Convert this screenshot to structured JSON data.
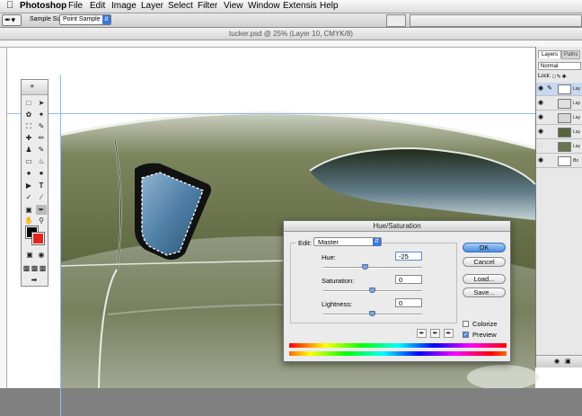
{
  "menubar": {
    "app_name": "Photoshop",
    "items": [
      "File",
      "Edit",
      "Image",
      "Layer",
      "Select",
      "Filter",
      "View",
      "Window",
      "Extensis",
      "Help"
    ]
  },
  "options_bar": {
    "sample_size_label": "Sample Size:",
    "sample_size_value": "Point Sample"
  },
  "document": {
    "title": "tucker.psd @ 25% (Layer 10, CMYK/8)"
  },
  "layers_panel": {
    "tab_layers": "Layers",
    "tab_paths": "Paths",
    "blend_mode": "Normal",
    "lock_label": "Lock:",
    "rows": [
      {
        "name": "Lay",
        "visible": true
      },
      {
        "name": "Lay",
        "visible": true
      },
      {
        "name": "Lay",
        "visible": true
      },
      {
        "name": "Lay",
        "visible": true
      },
      {
        "name": "Lay",
        "visible": false
      },
      {
        "name": "Bo",
        "visible": true
      }
    ]
  },
  "dialog": {
    "title": "Hue/Saturation",
    "edit_label": "Edit:",
    "edit_value": "Master",
    "hue_label": "Hue:",
    "hue_value": "-25",
    "hue_range": [
      -180,
      180
    ],
    "saturation_label": "Saturation:",
    "saturation_value": "0",
    "saturation_range": [
      -100,
      100
    ],
    "lightness_label": "Lightness:",
    "lightness_value": "0",
    "lightness_range": [
      -100,
      100
    ],
    "ok_label": "OK",
    "cancel_label": "Cancel",
    "load_label": "Load...",
    "save_label": "Save...",
    "colorize_label": "Colorize",
    "colorize_checked": false,
    "preview_label": "Preview",
    "preview_checked": true
  },
  "colors": {
    "foreground": "#000000",
    "background": "#e0261c",
    "car_body": "#7b8263",
    "window_glass": "#4e7ea4"
  }
}
